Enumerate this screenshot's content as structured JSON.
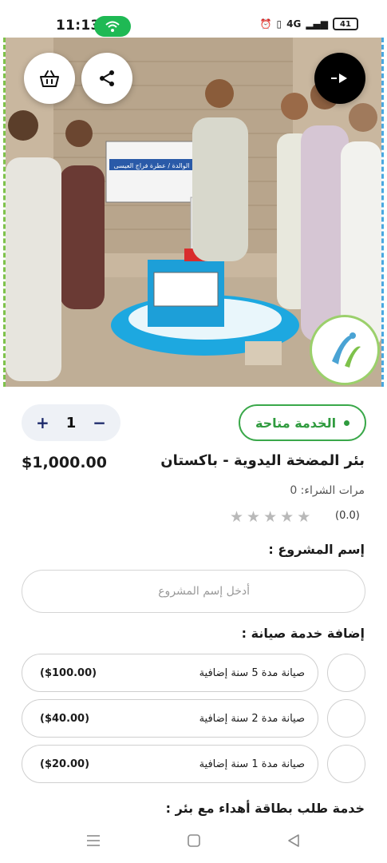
{
  "status": {
    "time": "11:13",
    "battery": "41",
    "network": "4G"
  },
  "hero": {
    "sign_text": "الوالدة / عطرة فراج العيسى",
    "icons": {
      "basket": "basket-icon",
      "share": "share-icon",
      "play": "play-icon",
      "logo": "charity-logo"
    }
  },
  "product": {
    "service_status": "الخدمة متاحة",
    "quantity": "1",
    "qty_plus": "+",
    "qty_minus": "−",
    "title": "بئر المضخة اليدوية - باكستان",
    "price": "$1,000.00",
    "purchase_count": "مرات الشراء: 0",
    "rating_value": "(0.0)",
    "rating": 0,
    "max_rating": 5
  },
  "form": {
    "project_name_label": "إسم المشروع :",
    "project_name_placeholder": "أدخل إسم المشروع",
    "project_name_value": "",
    "maintenance_label": "إضافة خدمة صيانة :",
    "maintenance_options": [
      {
        "name": "صيانة مدة 5 سنة إضافية",
        "price": "($100.00)"
      },
      {
        "name": "صيانة مدة 2 سنة إضافية",
        "price": "($40.00)"
      },
      {
        "name": "صيانة مدة 1 سنة إضافية",
        "price": "($20.00)"
      }
    ],
    "gift_card_label": "خدمة طلب بطاقة أهداء مع بئر :"
  },
  "colors": {
    "accent_green": "#2f9b3e",
    "qty_blue": "#1d2a6b",
    "wifi_green": "#1fb954"
  }
}
